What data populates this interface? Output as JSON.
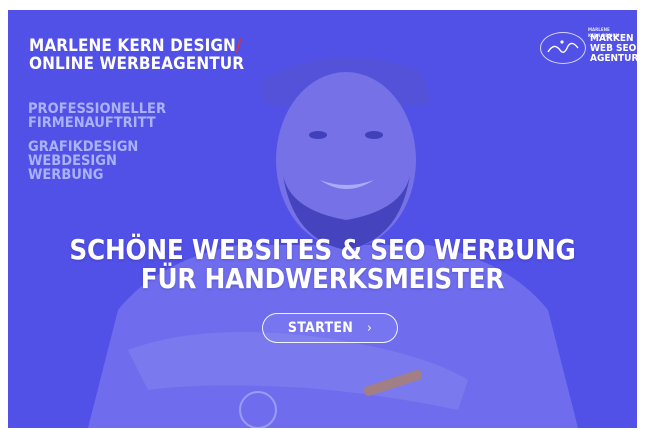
{
  "brand": {
    "line1": "MARLENE KERN DESIGN",
    "slash": "/",
    "line2": "ONLINE WERBEAGENTUR"
  },
  "tagline": {
    "group1": [
      "PROFESSIONELLER",
      "FIRMENAUFTRITT"
    ],
    "group2": [
      "GRAFIKDESIGN",
      "WEBDESIGN",
      "WERBUNG"
    ]
  },
  "badge": {
    "small_text": "MARLENE KERN DESIGN",
    "lines": [
      "MARKEN",
      "WEB SEO",
      "AGENTUR"
    ]
  },
  "hero": {
    "headline_line1": "SCHÖNE WEBSITES & SEO WERBUNG",
    "headline_line2": "FÜR HANDWERKSMEISTER",
    "cta_label": "STARTEN",
    "cta_icon": "chevron-right-icon"
  },
  "colors": {
    "overlay": "#4a4ceb",
    "accent_red": "#e6322f",
    "tagline": "#aab2f7",
    "text": "#ffffff"
  }
}
